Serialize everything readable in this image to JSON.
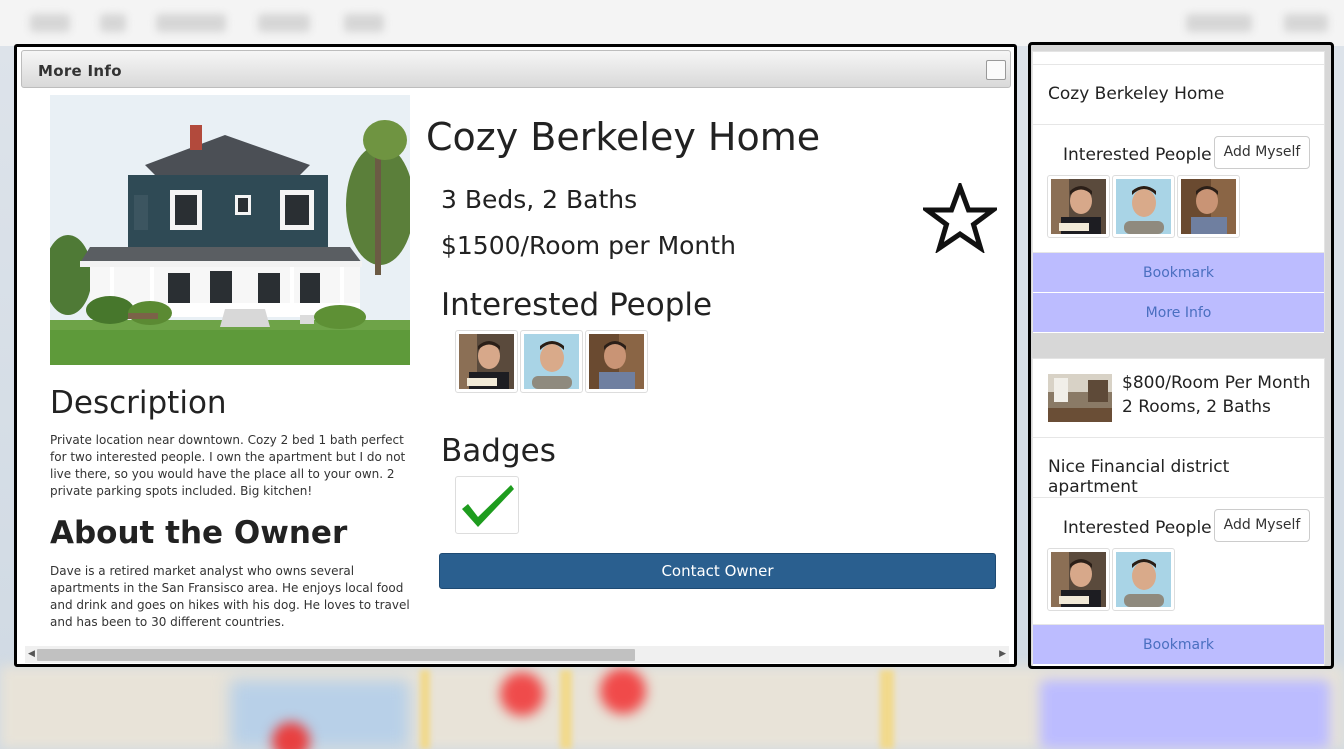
{
  "modal": {
    "title": "More Info",
    "home_title": "Cozy Berkeley Home",
    "beds_baths": "3 Beds, 2 Baths",
    "price": "$1500/Room per Month",
    "interested_heading": "Interested People",
    "badges_heading": "Badges",
    "description_heading": "Description",
    "description_text": "Private location near downtown. Cozy 2 bed 1 bath perfect for two interested people. I own the apartment but I do not live there, so you would have the place all to your own. 2 private parking spots included. Big kitchen!",
    "owner_heading": "About the Owner",
    "owner_text": "Dave is a retired market analyst who owns several apartments in the San Fransisco area. He enjoys local food and drink and goes on hikes with his dog. He loves to travel and has been to 30 different countries.",
    "contact_button": "Contact Owner"
  },
  "sidebar": {
    "card1": {
      "title": "Cozy Berkeley Home",
      "interested_label": "Interested People",
      "add_button": "Add Myself",
      "bookmark_button": "Bookmark",
      "more_info_button": "More Info"
    },
    "card2": {
      "price": "$800/Room Per Month",
      "rooms": "2 Rooms, 2 Baths",
      "title": "Nice Financial district apartment",
      "interested_label": "Interested People",
      "add_button": "Add Myself",
      "bookmark_button": "Bookmark"
    }
  },
  "colors": {
    "contact_button": "#2a5f8f",
    "side_button_bg": "#bcbcff",
    "side_button_text": "#4a6fc0",
    "badge_check": "#1e9c1e"
  },
  "icons": [
    "star-icon",
    "checkmark-icon",
    "close-icon",
    "scroll-left-icon",
    "scroll-right-icon"
  ]
}
